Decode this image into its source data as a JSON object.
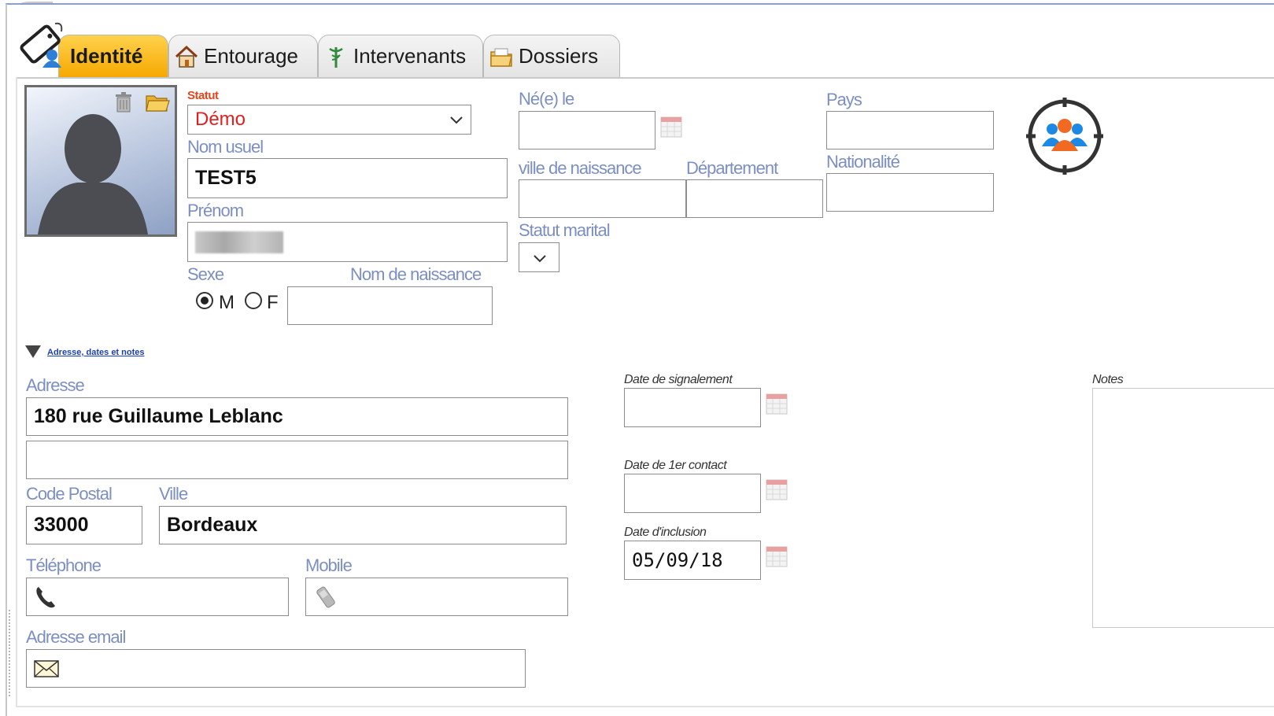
{
  "tabs": [
    {
      "label": "Identité",
      "icon": "tag-person-icon",
      "active": true
    },
    {
      "label": "Entourage",
      "icon": "house-icon",
      "active": false
    },
    {
      "label": "Intervenants",
      "icon": "caduceus-icon",
      "active": false
    },
    {
      "label": "Dossiers",
      "icon": "folder-icon",
      "active": false
    }
  ],
  "identity": {
    "statut_label": "Statut",
    "statut_value": "Démo",
    "nom_usuel_label": "Nom usuel",
    "nom_usuel_value": "TEST5",
    "prenom_label": "Prénom",
    "sexe_label": "Sexe",
    "sexe_options": [
      "M",
      "F"
    ],
    "sexe_selected": "M",
    "nom_naissance_label": "Nom de naissance",
    "nom_naissance_value": "",
    "ne_le_label": "Né(e) le",
    "ne_le_value": "",
    "ville_naissance_label": "ville de naissance",
    "ville_naissance_value": "",
    "departement_label": "Département",
    "departement_value": "",
    "statut_marital_label": "Statut marital",
    "statut_marital_value": "",
    "pays_label": "Pays",
    "pays_value": "",
    "nationalite_label": "Nationalité",
    "nationalite_value": ""
  },
  "section": {
    "toggle_label": "Adresse, dates et notes"
  },
  "address": {
    "adresse_label": "Adresse",
    "adresse_line1": "180 rue Guillaume Leblanc",
    "adresse_line2": "",
    "code_postal_label": "Code Postal",
    "code_postal_value": "33000",
    "ville_label": "Ville",
    "ville_value": "Bordeaux",
    "telephone_label": "Téléphone",
    "telephone_value": "",
    "mobile_label": "Mobile",
    "mobile_value": "",
    "email_label": "Adresse email",
    "email_value": ""
  },
  "dates": {
    "signalement_label": "Date de signalement",
    "signalement_value": "",
    "premier_contact_label": "Date de 1er contact",
    "premier_contact_value": "",
    "inclusion_label": "Date d'inclusion",
    "inclusion_value": "05/09/18"
  },
  "notes": {
    "label": "Notes",
    "value": ""
  },
  "colors": {
    "active_tab": "#f6a800",
    "label_blue": "#7c8fc2",
    "statut_red": "#e21f1f",
    "link_blue": "#1a3fb4"
  }
}
